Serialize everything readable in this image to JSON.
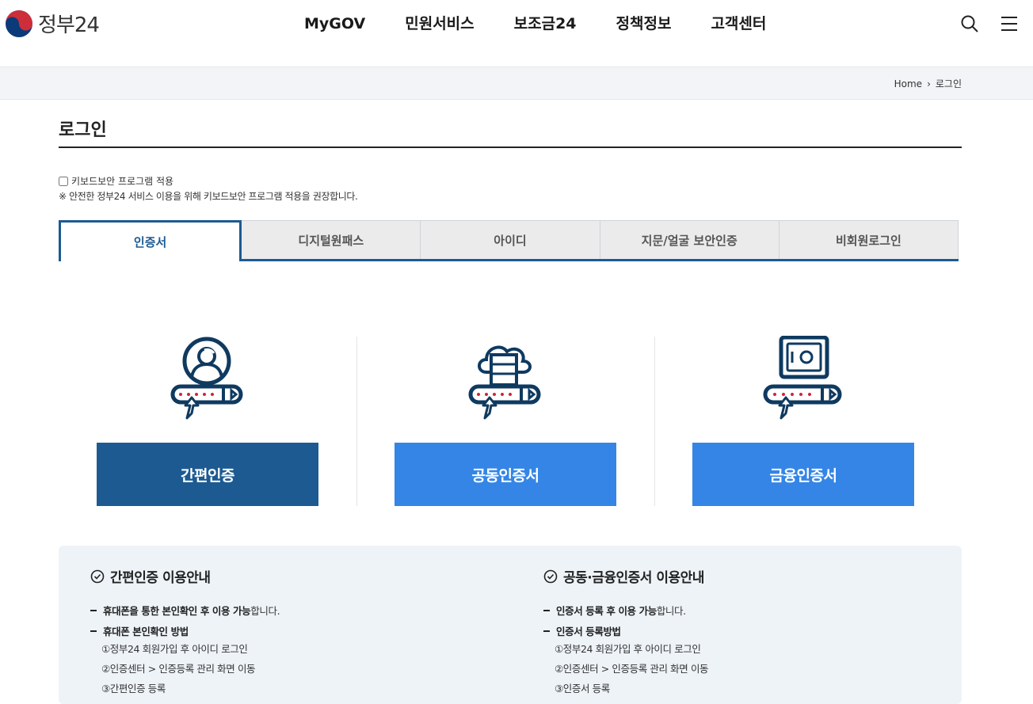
{
  "header": {
    "logo_text": "정부24",
    "nav": [
      "MyGOV",
      "민원서비스",
      "보조금24",
      "정책정보",
      "고객센터"
    ],
    "icons": [
      "search-icon",
      "hamburger-menu-icon"
    ]
  },
  "breadcrumb": {
    "home": "Home",
    "separator": "›",
    "current": "로그인"
  },
  "page": {
    "title": "로그인",
    "keyboard_checkbox_label": "키보드보안 프로그램 적용",
    "keyboard_checked": false,
    "keyboard_note": "※ 안전한 정부24 서비스 이용을 위해 키보드보안 프로그램 적용을 권장합니다."
  },
  "tabs": [
    {
      "label": "인증서",
      "active": true
    },
    {
      "label": "디지털원패스",
      "active": false
    },
    {
      "label": "아이디",
      "active": false
    },
    {
      "label": "지문/얼굴 보안인증",
      "active": false
    },
    {
      "label": "비회원로그인",
      "active": false
    }
  ],
  "login_options": [
    {
      "label": "간편인증",
      "icon": "user-password-icon",
      "color": "#1d5a92"
    },
    {
      "label": "공동인증서",
      "icon": "cloud-server-password-icon",
      "color": "#3485e6"
    },
    {
      "label": "금융인증서",
      "icon": "safe-password-icon",
      "color": "#3485e6"
    }
  ],
  "info": {
    "simple": {
      "title": "간편인증 이용안내",
      "bullet1_bold": "휴대폰을 통한 본인확인 후 이용 가능",
      "bullet1_rest": "합니다.",
      "bullet2_bold": "휴대폰 본인확인 방법",
      "steps": [
        "①정부24 회원가입 후 아이디 로그인",
        "②인증센터 > 인증등록 관리 화면 이동",
        "③간편인증 등록"
      ]
    },
    "cert": {
      "title": "공동·금융인증서 이용안내",
      "bullet1_bold": "인증서 등록 후 이용 가능",
      "bullet1_rest": "합니다.",
      "bullet2_bold": "인증서 등록방법",
      "steps": [
        "①정부24 회원가입 후 아이디 로그인",
        "②인증센터 > 인증등록 관리 화면 이동",
        "③인증서 등록"
      ]
    }
  },
  "colors": {
    "primary": "#1d5a92",
    "accent": "#3485e6",
    "info_bg": "#eef3f8"
  }
}
